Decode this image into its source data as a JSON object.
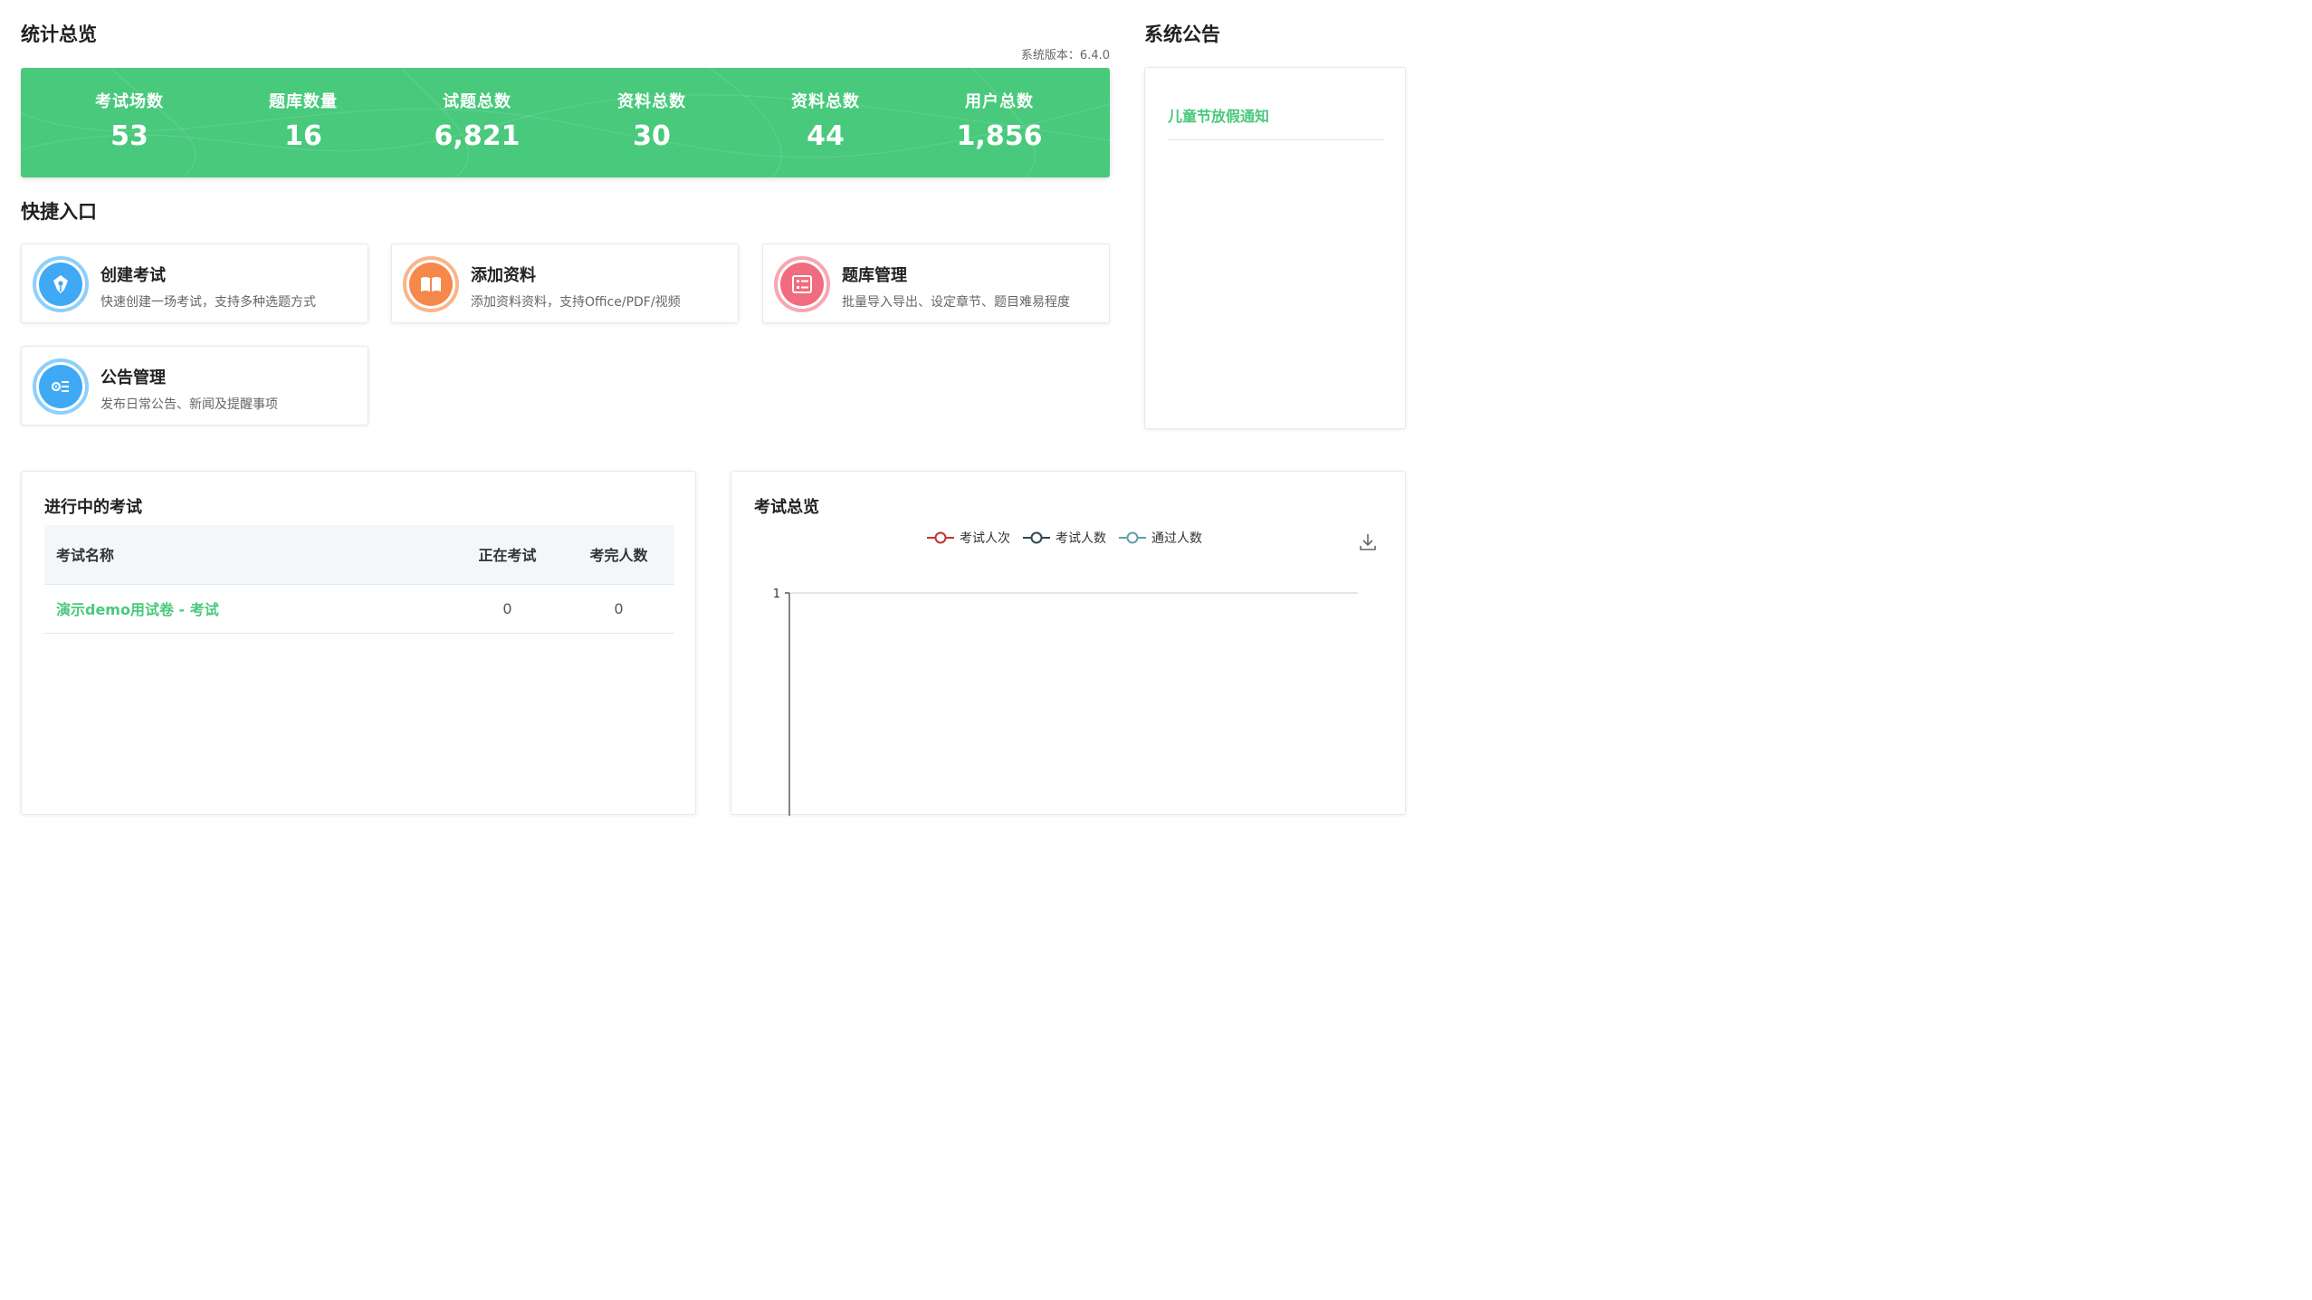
{
  "stats": {
    "title": "统计总览",
    "version_text": "系统版本：6.4.0",
    "items": [
      {
        "label": "考试场数",
        "value": "53"
      },
      {
        "label": "题库数量",
        "value": "16"
      },
      {
        "label": "试题总数",
        "value": "6,821"
      },
      {
        "label": "资料总数",
        "value": "30"
      },
      {
        "label": "资料总数",
        "value": "44"
      },
      {
        "label": "用户总数",
        "value": "1,856"
      }
    ]
  },
  "notice": {
    "title": "系统公告",
    "items": [
      {
        "text": "儿童节放假通知"
      }
    ]
  },
  "quick": {
    "title": "快捷入口",
    "items": [
      {
        "title": "创建考试",
        "desc": "快速创建一场考试，支持多种选题方式",
        "icon": "pen-icon",
        "color": "#3fa9f5"
      },
      {
        "title": "添加资料",
        "desc": "添加资料资料，支持Office/PDF/视频",
        "icon": "book-icon",
        "color": "#f5884a"
      },
      {
        "title": "题库管理",
        "desc": "批量导入导出、设定章节、题目难易程度",
        "icon": "list-icon",
        "color": "#f06c7e"
      },
      {
        "title": "公告管理",
        "desc": "发布日常公告、新闻及提醒事项",
        "icon": "settings-list-icon",
        "color": "#3fa9f5"
      }
    ]
  },
  "running_exams": {
    "title": "进行中的考试",
    "columns": [
      "考试名称",
      "正在考试",
      "考完人数"
    ],
    "rows": [
      {
        "name": "演示demo用试卷 - 考试",
        "in_progress": "0",
        "finished": "0"
      }
    ]
  },
  "exam_overview": {
    "title": "考试总览",
    "download_icon": "download-icon"
  },
  "chart_data": {
    "type": "line",
    "title": "考试总览",
    "series": [
      {
        "name": "考试人次",
        "color": "#c23531",
        "values": []
      },
      {
        "name": "考试人数",
        "color": "#2f4554",
        "values": []
      },
      {
        "name": "通过人数",
        "color": "#61a0a8",
        "values": []
      }
    ],
    "y_ticks": [
      "1"
    ],
    "legend_position": "top-center",
    "grid": true
  }
}
